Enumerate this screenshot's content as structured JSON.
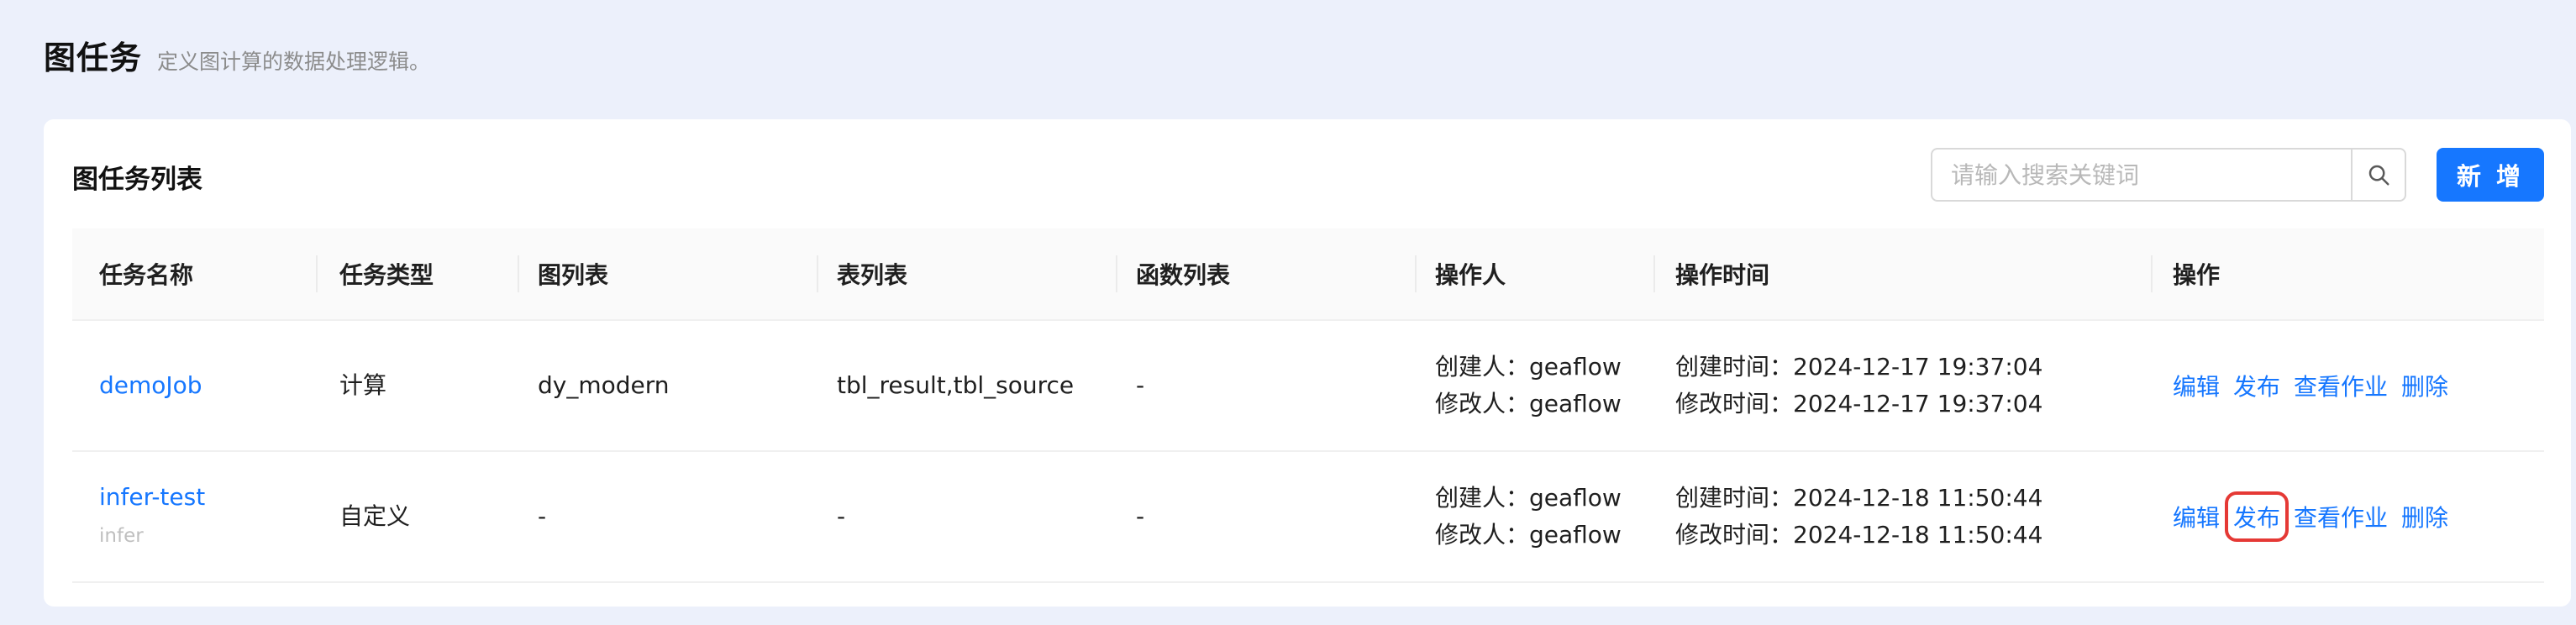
{
  "page": {
    "title": "图任务",
    "description": "定义图计算的数据处理逻辑。"
  },
  "card": {
    "title": "图任务列表",
    "search_placeholder": "请输入搜索关键词",
    "add_label": "新 增"
  },
  "table": {
    "headers": [
      "任务名称",
      "任务类型",
      "图列表",
      "表列表",
      "函数列表",
      "操作人",
      "操作时间",
      "操作"
    ],
    "rows": [
      {
        "name": "demoJob",
        "sub": "",
        "type": "计算",
        "graphs": "dy_modern",
        "tables": "tbl_result,tbl_source",
        "functions": "-",
        "creator": "创建人：geaflow",
        "modifier": "修改人：geaflow",
        "created": "创建时间：2024-12-17 19:37:04",
        "modified": "修改时间：2024-12-17 19:37:04",
        "actions": [
          "编辑",
          "发布",
          "查看作业",
          "删除"
        ]
      },
      {
        "name": "infer-test",
        "sub": "infer",
        "type": "自定义",
        "graphs": "-",
        "tables": "-",
        "functions": "-",
        "creator": "创建人：geaflow",
        "modifier": "修改人：geaflow",
        "created": "创建时间：2024-12-18 11:50:44",
        "modified": "修改时间：2024-12-18 11:50:44",
        "actions": [
          "编辑",
          "发布",
          "查看作业",
          "删除"
        ]
      }
    ]
  },
  "colors": {
    "accent": "#1677ff",
    "highlight": "#e53935",
    "background": "#ecf0fb"
  }
}
